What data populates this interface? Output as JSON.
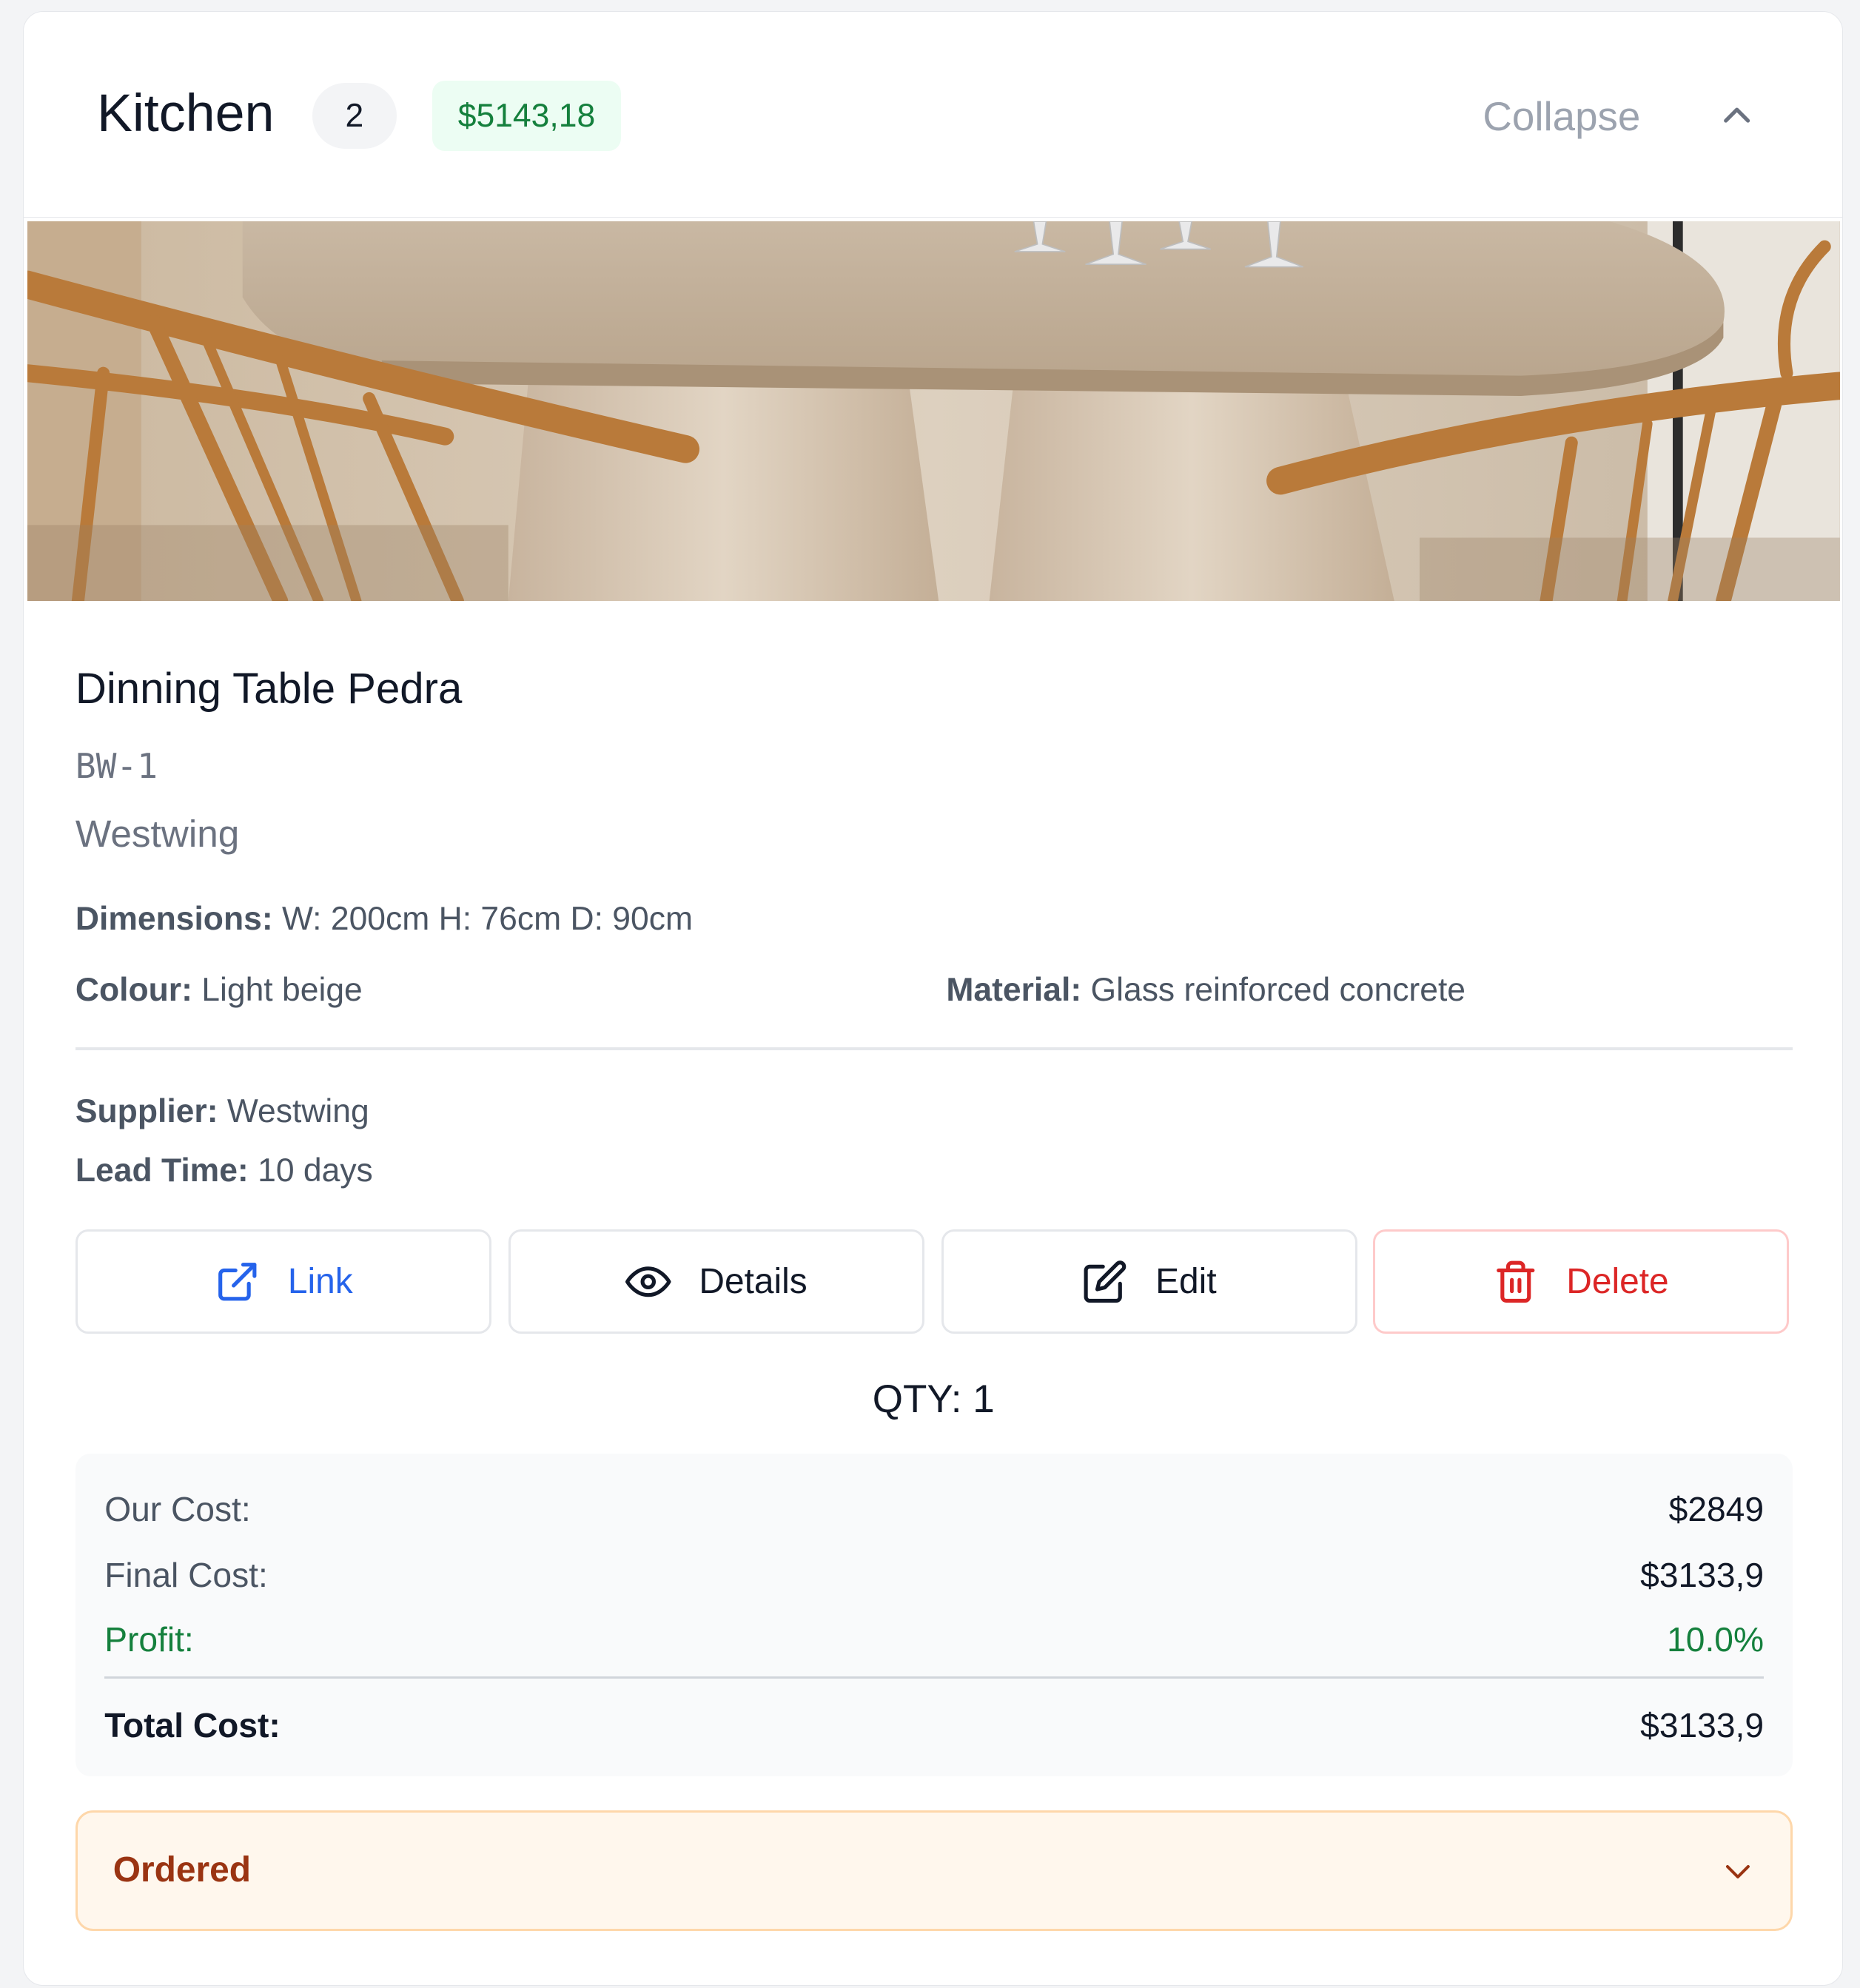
{
  "room": {
    "title": "Kitchen",
    "item_count": "2",
    "total": "$5143,18",
    "collapse_label": "Collapse"
  },
  "product": {
    "name": "Dinning Table Pedra",
    "sku": "BW-1",
    "brand": "Westwing",
    "dimensions_label": "Dimensions:",
    "dimensions_value": "W: 200cm H: 76cm D: 90cm",
    "colour_label": "Colour:",
    "colour_value": "Light beige",
    "material_label": "Material:",
    "material_value": "Glass reinforced concrete",
    "supplier_label": "Supplier:",
    "supplier_value": "Westwing",
    "lead_time_label": "Lead Time:",
    "lead_time_value": "10 days"
  },
  "actions": {
    "link": "Link",
    "details": "Details",
    "edit": "Edit",
    "delete": "Delete"
  },
  "qty_text": "QTY: 1",
  "costs": {
    "our_cost_label": "Our Cost:",
    "our_cost_value": "$2849",
    "final_cost_label": "Final Cost:",
    "final_cost_value": "$3133,9",
    "profit_label": "Profit:",
    "profit_value": "10.0%",
    "total_cost_label": "Total Cost:",
    "total_cost_value": "$3133,9"
  },
  "status": {
    "selected": "Ordered"
  },
  "colors": {
    "accent_link": "#2563eb",
    "danger": "#dc2626",
    "profit_green": "#15803d",
    "status_text": "#9a3412",
    "status_bg": "#fff7ed"
  },
  "icons": {
    "collapse": "chevron-up-icon",
    "link": "external-link-icon",
    "details": "eye-icon",
    "edit": "edit-icon",
    "delete": "trash-icon",
    "status": "chevron-down-icon"
  }
}
